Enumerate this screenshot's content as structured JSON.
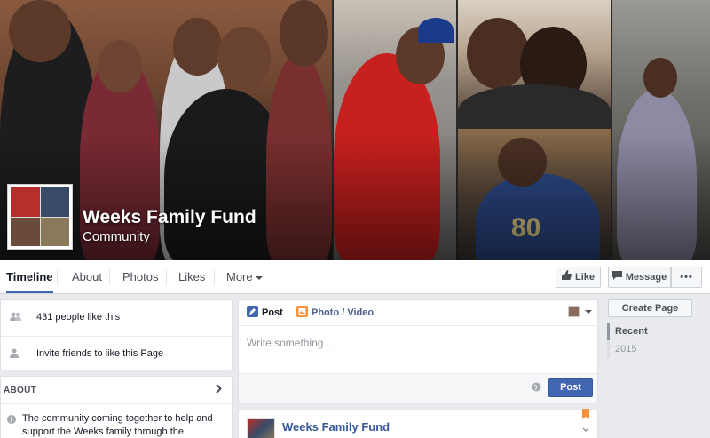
{
  "cover": {
    "page_name": "Weeks Family Fund",
    "category": "Community"
  },
  "nav": {
    "tabs": [
      {
        "label": "Timeline",
        "active": true
      },
      {
        "label": "About"
      },
      {
        "label": "Photos"
      },
      {
        "label": "Likes"
      },
      {
        "label": "More"
      }
    ],
    "like_label": "Like",
    "message_label": "Message",
    "more_options_label": "•••"
  },
  "left": {
    "likes_text": "431 people like this",
    "invite_text": "Invite friends to like this Page",
    "about_heading": "ABOUT",
    "about_description": "The community coming together to help and support the Weeks family through the devastating"
  },
  "composer": {
    "post_tab": "Post",
    "photo_tab": "Photo / Video",
    "placeholder": "Write something...",
    "post_button": "Post"
  },
  "feed": {
    "first_post_author": "Weeks Family Fund"
  },
  "right": {
    "create_page_label": "Create Page",
    "years": [
      {
        "label": "Recent",
        "active": true
      },
      {
        "label": "2015"
      }
    ]
  },
  "colors": {
    "accent": "#4267b2",
    "link": "#365899",
    "background": "#e9eaed"
  }
}
